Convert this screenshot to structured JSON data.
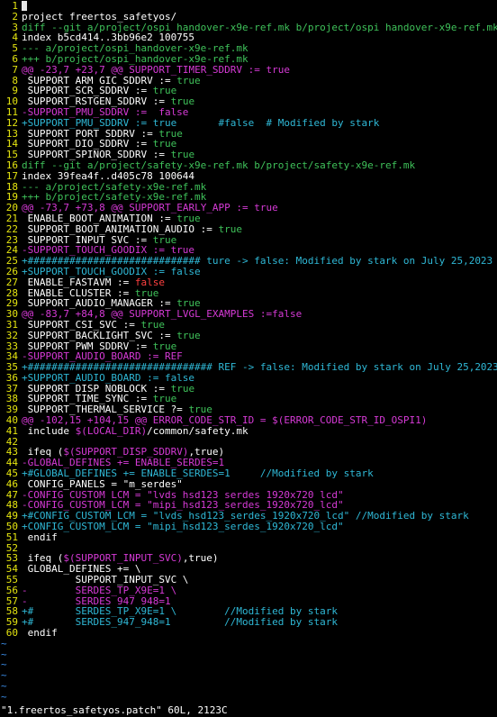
{
  "colors": {
    "background": "#000000",
    "line_number": "#e5e510",
    "normal": "#ffffff",
    "diff_header": "#3fc25a",
    "hunk_and_removed": "#d63ad6",
    "added": "#2fb8d6",
    "value_false": "#ff4040",
    "tilde": "#3b8eea"
  },
  "lines": [
    {
      "n": "1",
      "cursor": true,
      "segs": []
    },
    {
      "n": "2",
      "segs": [
        {
          "t": "project freertos_safetyos/",
          "c": "n"
        }
      ]
    },
    {
      "n": "3",
      "segs": [
        {
          "t": "diff --git a/project/ospi_handover-x9e-ref.mk b/project/ospi_handover-x9e-ref.mk",
          "c": "g"
        }
      ]
    },
    {
      "n": "4",
      "segs": [
        {
          "t": "index b5cd414..3bb96e2 100755",
          "c": "n"
        }
      ]
    },
    {
      "n": "5",
      "segs": [
        {
          "t": "--- a/project/ospi_handover-x9e-ref.mk",
          "c": "g"
        }
      ]
    },
    {
      "n": "6",
      "segs": [
        {
          "t": "+++ b/project/ospi_handover-x9e-ref.mk",
          "c": "g"
        }
      ]
    },
    {
      "n": "7",
      "segs": [
        {
          "t": "@@ -23,7 +23,7 @@ ",
          "c": "p"
        },
        {
          "t": "SUPPORT_TIMER_SDDRV := true",
          "c": "p"
        }
      ]
    },
    {
      "n": "8",
      "segs": [
        {
          "t": " SUPPORT_ARM_GIC_SDDRV := ",
          "c": "n"
        },
        {
          "t": "true",
          "c": "g"
        }
      ]
    },
    {
      "n": "9",
      "segs": [
        {
          "t": " SUPPORT_SCR_SDDRV := ",
          "c": "n"
        },
        {
          "t": "true",
          "c": "g"
        }
      ]
    },
    {
      "n": "10",
      "segs": [
        {
          "t": " SUPPORT_RSTGEN_SDDRV := ",
          "c": "n"
        },
        {
          "t": "true",
          "c": "g"
        }
      ]
    },
    {
      "n": "11",
      "segs": [
        {
          "t": "-SUPPORT_PMU_SDDRV :=  false",
          "c": "p"
        }
      ]
    },
    {
      "n": "12",
      "segs": [
        {
          "t": "+SUPPORT_PMU_SDDRV := true       #false  # Modified by stark",
          "c": "c"
        }
      ]
    },
    {
      "n": "13",
      "segs": [
        {
          "t": " SUPPORT_PORT_SDDRV := ",
          "c": "n"
        },
        {
          "t": "true",
          "c": "g"
        }
      ]
    },
    {
      "n": "14",
      "segs": [
        {
          "t": " SUPPORT_DIO_SDDRV := ",
          "c": "n"
        },
        {
          "t": "true",
          "c": "g"
        }
      ]
    },
    {
      "n": "15",
      "segs": [
        {
          "t": " SUPPORT_SPINOR_SDDRV := ",
          "c": "n"
        },
        {
          "t": "true",
          "c": "g"
        }
      ]
    },
    {
      "n": "16",
      "segs": [
        {
          "t": "diff --git a/project/safety-x9e-ref.mk b/project/safety-x9e-ref.mk",
          "c": "g"
        }
      ]
    },
    {
      "n": "17",
      "segs": [
        {
          "t": "index 39fea4f..d405c78 100644",
          "c": "n"
        }
      ]
    },
    {
      "n": "18",
      "segs": [
        {
          "t": "--- a/project/safety-x9e-ref.mk",
          "c": "g"
        }
      ]
    },
    {
      "n": "19",
      "segs": [
        {
          "t": "+++ b/project/safety-x9e-ref.mk",
          "c": "g"
        }
      ]
    },
    {
      "n": "20",
      "segs": [
        {
          "t": "@@ -73,7 +73,8 @@ ",
          "c": "p"
        },
        {
          "t": "SUPPORT_EARLY_APP := true",
          "c": "p"
        }
      ]
    },
    {
      "n": "21",
      "segs": [
        {
          "t": " ENABLE_BOOT_ANIMATION := ",
          "c": "n"
        },
        {
          "t": "true",
          "c": "g"
        }
      ]
    },
    {
      "n": "22",
      "segs": [
        {
          "t": " SUPPORT_BOOT_ANIMATION_AUDIO := ",
          "c": "n"
        },
        {
          "t": "true",
          "c": "g"
        }
      ]
    },
    {
      "n": "23",
      "segs": [
        {
          "t": " SUPPORT_INPUT_SVC := ",
          "c": "n"
        },
        {
          "t": "true",
          "c": "g"
        }
      ]
    },
    {
      "n": "24",
      "segs": [
        {
          "t": "-SUPPORT_TOUCH_GOODIX := true",
          "c": "p"
        }
      ]
    },
    {
      "n": "25",
      "segs": [
        {
          "t": "+############################# ture -> false: Modified by stark on July 25,2023",
          "c": "c"
        }
      ]
    },
    {
      "n": "26",
      "segs": [
        {
          "t": "+SUPPORT_TOUCH_GOODIX := false",
          "c": "c"
        }
      ]
    },
    {
      "n": "27",
      "segs": [
        {
          "t": " ENABLE_FASTAVM := ",
          "c": "n"
        },
        {
          "t": "false",
          "c": "r"
        }
      ]
    },
    {
      "n": "28",
      "segs": [
        {
          "t": " ENABLE_CLUSTER := ",
          "c": "n"
        },
        {
          "t": "true",
          "c": "g"
        }
      ]
    },
    {
      "n": "29",
      "segs": [
        {
          "t": " SUPPORT_AUDIO_MANAGER := ",
          "c": "n"
        },
        {
          "t": "true",
          "c": "g"
        }
      ]
    },
    {
      "n": "30",
      "segs": [
        {
          "t": "@@ -83,7 +84,8 @@ ",
          "c": "p"
        },
        {
          "t": "SUPPORT_LVGL_EXAMPLES :=false",
          "c": "p"
        }
      ]
    },
    {
      "n": "31",
      "segs": [
        {
          "t": " SUPPORT_CSI_SVC := ",
          "c": "n"
        },
        {
          "t": "true",
          "c": "g"
        }
      ]
    },
    {
      "n": "32",
      "segs": [
        {
          "t": " SUPPORT_BACKLIGHT_SVC := ",
          "c": "n"
        },
        {
          "t": "true",
          "c": "g"
        }
      ]
    },
    {
      "n": "33",
      "segs": [
        {
          "t": " SUPPORT_PWM_SDDRV := ",
          "c": "n"
        },
        {
          "t": "true",
          "c": "g"
        }
      ]
    },
    {
      "n": "34",
      "segs": [
        {
          "t": "-SUPPORT_AUDIO_BOARD := REF",
          "c": "p"
        }
      ]
    },
    {
      "n": "35",
      "segs": [
        {
          "t": "+############################### REF -> false: Modified by stark on July 25,2023",
          "c": "c"
        }
      ]
    },
    {
      "n": "36",
      "segs": [
        {
          "t": "+SUPPORT_AUDIO_BOARD := false",
          "c": "c"
        }
      ]
    },
    {
      "n": "37",
      "segs": [
        {
          "t": " SUPPORT_DISP_NOBLOCK := ",
          "c": "n"
        },
        {
          "t": "true",
          "c": "g"
        }
      ]
    },
    {
      "n": "38",
      "segs": [
        {
          "t": " SUPPORT_TIME_SYNC := ",
          "c": "n"
        },
        {
          "t": "true",
          "c": "g"
        }
      ]
    },
    {
      "n": "39",
      "segs": [
        {
          "t": " SUPPORT_THERMAL_SERVICE ?= ",
          "c": "n"
        },
        {
          "t": "true",
          "c": "g"
        }
      ]
    },
    {
      "n": "40",
      "segs": [
        {
          "t": "@@ -102,15 +104,15 @@ ",
          "c": "p"
        },
        {
          "t": "ERROR_CODE_STR_ID = $(ERROR_CODE_STR_ID_OSPI1)",
          "c": "p"
        }
      ]
    },
    {
      "n": "41",
      "segs": [
        {
          "t": " include ",
          "c": "n"
        },
        {
          "t": "$(LOCAL_DIR)",
          "c": "p"
        },
        {
          "t": "/common/safety.mk",
          "c": "n"
        }
      ]
    },
    {
      "n": "42",
      "segs": []
    },
    {
      "n": "43",
      "segs": [
        {
          "t": " ifeq (",
          "c": "n"
        },
        {
          "t": "$(SUPPORT_DISP_SDDRV)",
          "c": "p"
        },
        {
          "t": ",true)",
          "c": "n"
        }
      ]
    },
    {
      "n": "44",
      "segs": [
        {
          "t": "-GLOBAL_DEFINES += ENABLE_SERDES=1",
          "c": "p"
        }
      ]
    },
    {
      "n": "45",
      "segs": [
        {
          "t": "+#GLOBAL_DEFINES += ENABLE_SERDES=1     //Modified by stark",
          "c": "c"
        }
      ]
    },
    {
      "n": "46",
      "segs": [
        {
          "t": " CONFIG_PANELS = \"m_serdes\"",
          "c": "n"
        }
      ]
    },
    {
      "n": "47",
      "segs": [
        {
          "t": "-CONFIG_CUSTOM_LCM = \"lvds_hsd123_serdes_1920x720_lcd\"",
          "c": "p"
        }
      ]
    },
    {
      "n": "48",
      "segs": [
        {
          "t": "-CONFIG_CUSTOM_LCM = \"mipi_hsd123_serdes_1920x720_lcd\"",
          "c": "p"
        }
      ]
    },
    {
      "n": "49",
      "segs": [
        {
          "t": "+#CONFIG_CUSTOM_LCM = \"lvds_hsd123_serdes_1920x720_lcd\" //Modified by stark",
          "c": "c"
        }
      ]
    },
    {
      "n": "50",
      "segs": [
        {
          "t": "+CONFIG_CUSTOM_LCM = \"mipi_hsd123_serdes_1920x720_lcd\"",
          "c": "c"
        }
      ]
    },
    {
      "n": "51",
      "segs": [
        {
          "t": " endif",
          "c": "n"
        }
      ]
    },
    {
      "n": "52",
      "segs": []
    },
    {
      "n": "53",
      "segs": [
        {
          "t": " ifeq (",
          "c": "n"
        },
        {
          "t": "$(SUPPORT_INPUT_SVC)",
          "c": "p"
        },
        {
          "t": ",true)",
          "c": "n"
        }
      ]
    },
    {
      "n": "54",
      "segs": [
        {
          "t": " GLOBAL_DEFINES += \\",
          "c": "n"
        }
      ]
    },
    {
      "n": "55",
      "segs": [
        {
          "t": "         SUPPORT_INPUT_SVC \\",
          "c": "n"
        }
      ]
    },
    {
      "n": "56",
      "segs": [
        {
          "t": "-        SERDES_TP_X9E=1 \\",
          "c": "p"
        }
      ]
    },
    {
      "n": "57",
      "segs": [
        {
          "t": "-        SERDES_947_948=1",
          "c": "p"
        }
      ]
    },
    {
      "n": "58",
      "segs": [
        {
          "t": "+#       SERDES_TP_X9E=1 \\        //Modified by stark",
          "c": "c"
        }
      ]
    },
    {
      "n": "59",
      "segs": [
        {
          "t": "+#       SERDES_947_948=1         //Modified by stark",
          "c": "c"
        }
      ]
    },
    {
      "n": "60",
      "segs": [
        {
          "t": " endif",
          "c": "n"
        }
      ]
    }
  ],
  "tildes": [
    "~",
    "~",
    "~",
    "~",
    "~",
    "~"
  ],
  "status_line": "\"1.freertos_safetyos.patch\" 60L, 2123C"
}
